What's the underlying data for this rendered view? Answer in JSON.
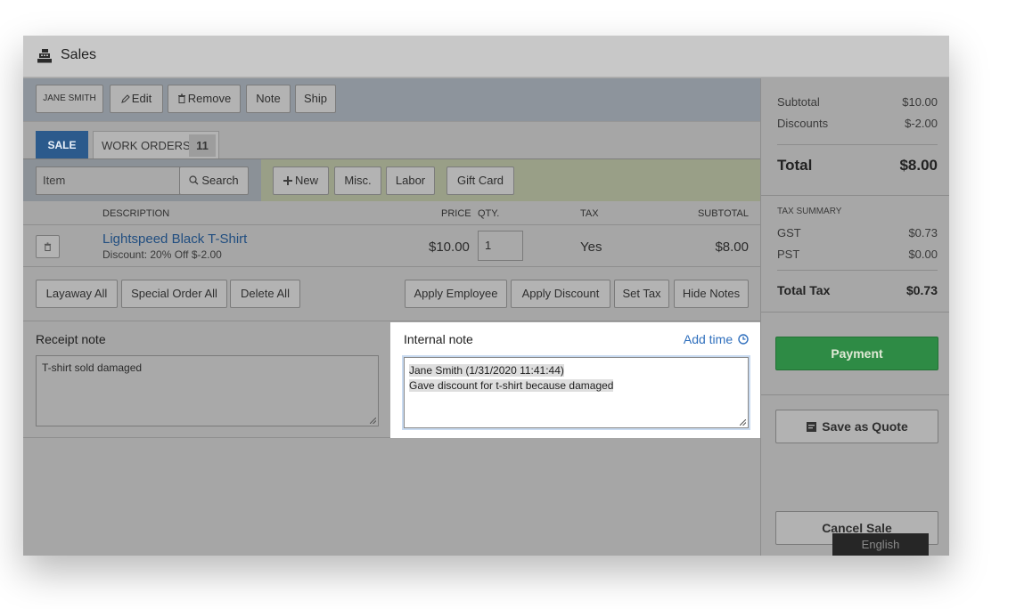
{
  "window": {
    "title": "Sales",
    "icon": "cash-register-icon"
  },
  "customer_bar": {
    "customer_name": "JANE SMITH",
    "edit_label": "Edit",
    "remove_label": "Remove",
    "note_label": "Note",
    "ship_label": "Ship"
  },
  "tabs": {
    "sale_label": "SALE",
    "work_orders_label": "WORK ORDERS",
    "work_orders_count": "11"
  },
  "item_bar": {
    "item_placeholder": "Item",
    "search_label": "Search",
    "new_label": "New",
    "misc_label": "Misc.",
    "labor_label": "Labor",
    "gift_card_label": "Gift Card"
  },
  "table": {
    "headers": {
      "description": "DESCRIPTION",
      "price": "PRICE",
      "qty": "QTY.",
      "tax": "TAX",
      "subtotal": "SUBTOTAL"
    },
    "rows": [
      {
        "description": "Lightspeed Black T-Shirt",
        "discount": "Discount: 20% Off $-2.00",
        "price": "$10.00",
        "qty": "1",
        "tax": "Yes",
        "subtotal": "$8.00"
      }
    ]
  },
  "actions": {
    "layaway_all": "Layaway All",
    "special_order_all": "Special Order All",
    "delete_all": "Delete All",
    "apply_employee": "Apply Employee",
    "apply_discount": "Apply Discount",
    "set_tax": "Set Tax",
    "hide_notes": "Hide Notes"
  },
  "notes": {
    "receipt_label": "Receipt note",
    "receipt_value": "T-shirt sold damaged",
    "internal_label": "Internal note",
    "add_time_label": "Add time",
    "internal_line1": "Jane Smith (1/31/2020 11:41:44)",
    "internal_line2": "Gave discount for t-shirt because damaged"
  },
  "summary": {
    "subtotal_label": "Subtotal",
    "subtotal_value": "$10.00",
    "discounts_label": "Discounts",
    "discounts_value": "$-2.00",
    "total_label": "Total",
    "total_value": "$8.00",
    "tax_summary_label": "TAX SUMMARY",
    "gst_label": "GST",
    "gst_value": "$0.73",
    "pst_label": "PST",
    "pst_value": "$0.00",
    "total_tax_label": "Total Tax",
    "total_tax_value": "$0.73",
    "payment_label": "Payment",
    "save_quote_label": "Save as Quote",
    "cancel_sale_label": "Cancel Sale"
  },
  "tooltip": {
    "language": "English"
  },
  "colors": {
    "payment_green": "#2e8b45",
    "sale_tab_blue": "#2b5a8c",
    "link_blue": "#2f6fbd"
  }
}
